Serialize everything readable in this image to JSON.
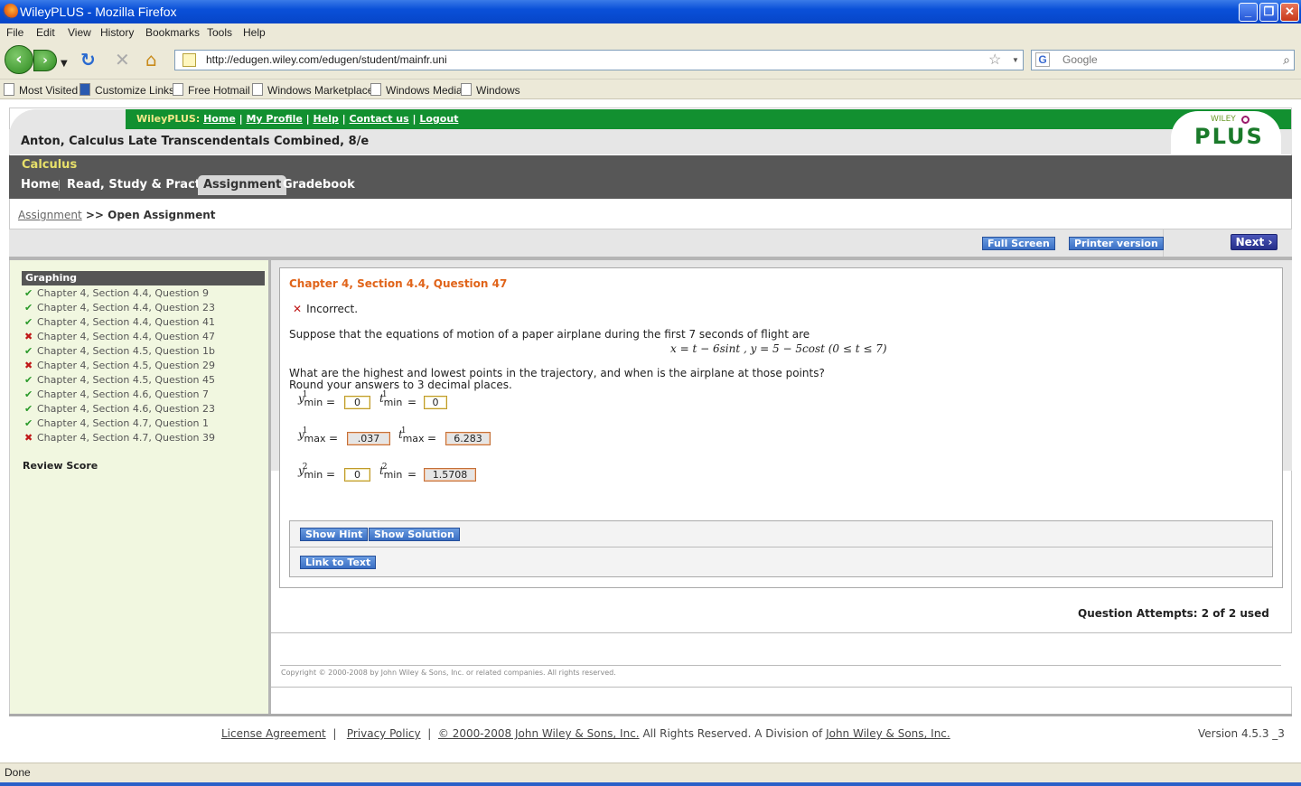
{
  "window": {
    "title": "WileyPLUS - Mozilla Firefox"
  },
  "menu": [
    "File",
    "Edit",
    "View",
    "History",
    "Bookmarks",
    "Tools",
    "Help"
  ],
  "nav": {
    "url": "http://edugen.wiley.com/edugen/student/mainfr.uni",
    "search_placeholder": "Google"
  },
  "bookmarks": [
    "Most Visited",
    "Customize Links",
    "Free Hotmail",
    "Windows Marketplace",
    "Windows Media",
    "Windows"
  ],
  "site": {
    "brand_label": "WileyPLUS:",
    "top_links": [
      "Home",
      "My Profile",
      "Help",
      "Contact us",
      "Logout"
    ],
    "course_name": "Anton, Calculus Late Transcendentals Combined, 8/e",
    "logo_top": "WILEY",
    "logo_main": "PLUS",
    "subject": "Calculus",
    "tabs": [
      "Home",
      "Read, Study & Practice",
      "Assignment",
      "Gradebook"
    ],
    "active_tab": "Assignment",
    "breadcrumb": {
      "link": "Assignment",
      "sep": ">>",
      "current": "Open Assignment"
    },
    "toolbar": {
      "full_screen": "Full Screen",
      "printer": "Printer version",
      "next": "Next ›"
    }
  },
  "sidebar": {
    "heading": "Graphing",
    "items": [
      {
        "label": "Chapter 4, Section 4.4, Question 9",
        "status": "correct"
      },
      {
        "label": "Chapter 4, Section 4.4, Question 23",
        "status": "correct"
      },
      {
        "label": "Chapter 4, Section 4.4, Question 41",
        "status": "correct"
      },
      {
        "label": "Chapter 4, Section 4.4, Question 47",
        "status": "incorrect"
      },
      {
        "label": "Chapter 4, Section 4.5, Question 1b",
        "status": "correct"
      },
      {
        "label": "Chapter 4, Section 4.5, Question 29",
        "status": "incorrect"
      },
      {
        "label": "Chapter 4, Section 4.5, Question 45",
        "status": "correct"
      },
      {
        "label": "Chapter 4, Section 4.6, Question 7",
        "status": "correct"
      },
      {
        "label": "Chapter 4, Section 4.6, Question 23",
        "status": "correct"
      },
      {
        "label": "Chapter 4, Section 4.7, Question 1",
        "status": "correct"
      },
      {
        "label": "Chapter 4, Section 4.7, Question 39",
        "status": "incorrect"
      }
    ],
    "review_score": "Review Score"
  },
  "question": {
    "title": "Chapter 4, Section 4.4, Question 47",
    "result": "Incorrect.",
    "prompt": "Suppose that the equations of motion of a paper airplane during the first 7 seconds of flight are",
    "equation": "x = t − 6sint ,   y = 5 − 5cost   (0 ≤ t ≤ 7)",
    "ask_1": "What are the highest and lowest points in the trajectory, and when is the airplane at those points?",
    "ask_2": "Round your answers to 3 decimal places.",
    "answers": [
      {
        "y_sup": "1",
        "y_sub": "min",
        "y_val": "0",
        "y_status": "correct",
        "t_sup": "1",
        "t_sub": "min",
        "t_val": "0",
        "t_status": "correct"
      },
      {
        "y_sup": "1",
        "y_sub": "max",
        "y_val": ".037",
        "y_status": "incorrect",
        "t_sup": "1",
        "t_sub": "max",
        "t_val": "6.283",
        "t_status": "incorrect"
      },
      {
        "y_sup": "2",
        "y_sub": "min",
        "y_val": "0",
        "y_status": "correct",
        "t_sup": "2",
        "t_sub": "min",
        "t_val": "1.5708",
        "t_status": "incorrect"
      }
    ],
    "buttons": {
      "hint": "Show Hint",
      "solution": "Show Solution",
      "link_text": "Link to Text"
    },
    "attempts": "Question Attempts: 2 of 2 used"
  },
  "copyright_small": "Copyright © 2000-2008 by John Wiley & Sons, Inc. or related companies. All rights reserved.",
  "footer": {
    "license": "License Agreement",
    "privacy": "Privacy Policy",
    "copyright_link": "© 2000-2008 John Wiley & Sons, Inc.",
    "rights": "All Rights Reserved. A Division of",
    "division_link": "John Wiley & Sons, Inc.",
    "version": "Version 4.5.3 _3"
  },
  "status": "Done"
}
